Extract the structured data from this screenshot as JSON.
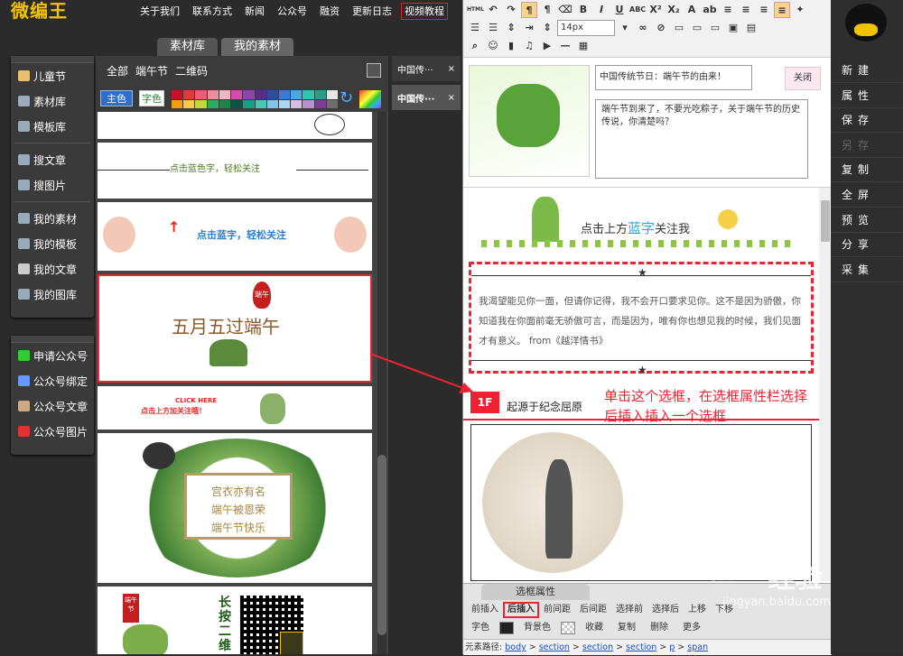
{
  "app": {
    "logo": "微编王"
  },
  "topnav": [
    "关于我们",
    "联系方式",
    "新闻",
    "公众号",
    "融资",
    "更新日志",
    "视频教程"
  ],
  "sidebar": {
    "group1": [
      {
        "label": "儿童节",
        "icon": "child-icon",
        "color": "#e8c070"
      },
      {
        "label": "素材库",
        "icon": "library-icon",
        "color": "#9ab"
      },
      {
        "label": "模板库",
        "icon": "template-icon",
        "color": "#9ab"
      },
      {
        "label": "搜文章",
        "icon": "search-article-icon",
        "color": "#9ab"
      },
      {
        "label": "搜图片",
        "icon": "search-image-icon",
        "color": "#9ab"
      },
      {
        "label": "我的素材",
        "icon": "my-material-icon",
        "color": "#9ab"
      },
      {
        "label": "我的模板",
        "icon": "my-template-icon",
        "color": "#9ab"
      },
      {
        "label": "我的文章",
        "icon": "my-article-icon",
        "color": "#ccc"
      },
      {
        "label": "我的图库",
        "icon": "my-gallery-icon",
        "color": "#9ab"
      }
    ],
    "group2": [
      {
        "label": "申请公众号",
        "icon": "wechat-icon",
        "color": "#3c3"
      },
      {
        "label": "公众号绑定",
        "icon": "pen-icon",
        "color": "#69f"
      },
      {
        "label": "公众号文章",
        "icon": "book-icon",
        "color": "#ca8"
      },
      {
        "label": "公众号图片",
        "icon": "image-icon",
        "color": "#d33"
      }
    ]
  },
  "library": {
    "tabs": [
      "素材库",
      "我的素材"
    ],
    "filter": [
      "全部",
      "端午节",
      "二维码"
    ],
    "btn_primary": "主色",
    "btn_secondary": "字色",
    "swatches": [
      "#c8102e",
      "#e03a3a",
      "#ef5a7a",
      "#f08ca0",
      "#f4b4c4",
      "#d74bb1",
      "#8e44ad",
      "#5b2c83",
      "#2f4ea0",
      "#3a7bd5",
      "#49a7e5",
      "#2ec4b6",
      "#2a9d8f",
      "#e6e6e6",
      "#f39c12",
      "#f7c948",
      "#c0d83a",
      "#27ae60",
      "#1e8449",
      "#0b5345",
      "#16a085",
      "#48c9b0",
      "#85c1e9",
      "#aed6f1",
      "#d7bde2",
      "#bb8fce",
      "#7d3c98",
      "#6e6e6e"
    ],
    "cards": [
      {
        "text": "点击蓝色字，轻松关注"
      },
      {
        "text": "点击蓝字，轻松关注"
      },
      {
        "title": "五月五过端午",
        "seal": "端午"
      },
      {
        "text": "点击上方加关注哦！",
        "badge": "CLICK HERE"
      },
      {
        "lines": [
          "宫衣亦有名",
          "端午被恩荣",
          "端午节快乐"
        ]
      },
      {
        "seal": "端午节",
        "text": "长按二维"
      }
    ]
  },
  "doctabs": [
    {
      "label": "中国传···",
      "close": "×"
    },
    {
      "label": "中国传···",
      "close": "×"
    }
  ],
  "editor": {
    "font_size": "14px",
    "title": "中国传统节日：端午节的由来！",
    "close": "关闭",
    "summary": "端午节到来了，不要光吃粽子，关于端午节的历史传说，你清楚吗？",
    "follow_text": "点击上方",
    "follow_blue": "蓝字",
    "follow_tail": "关注我",
    "quote": "我渴望能见你一面，但请你记得，我不会开口要求见你。这不是因为骄傲，你知道我在你面前毫无骄傲可言，而是因为，唯有你也想见我的时候，我们见面才有意义。 from《越洋情书》",
    "star": "★",
    "floor": "1F",
    "floor_title": "起源于纪念屈原",
    "annotation": "单击这个选框，在选框属性栏选择后插入插入一个选框"
  },
  "props": {
    "title": "选框属性",
    "row1": [
      "前插入",
      "后插入",
      "前间距",
      "后间距",
      "选择前",
      "选择后",
      "上移",
      "下移"
    ],
    "row2_font": "字色",
    "row2_bg": "背景色",
    "row2_btns": [
      "收藏",
      "复制",
      "删除",
      "更多"
    ],
    "path_label": "元素路径:",
    "path": [
      "body",
      "section",
      "section",
      "section",
      "p",
      "span"
    ],
    "path_sep": ">"
  },
  "rightpanel": [
    "新建",
    "属性",
    "保存",
    "另存",
    "复制",
    "全屏",
    "预览",
    "分享",
    "采集"
  ],
  "watermark": {
    "brand": "Bai",
    "brand2": "经验",
    "url": "jingyan.baidu.com"
  }
}
